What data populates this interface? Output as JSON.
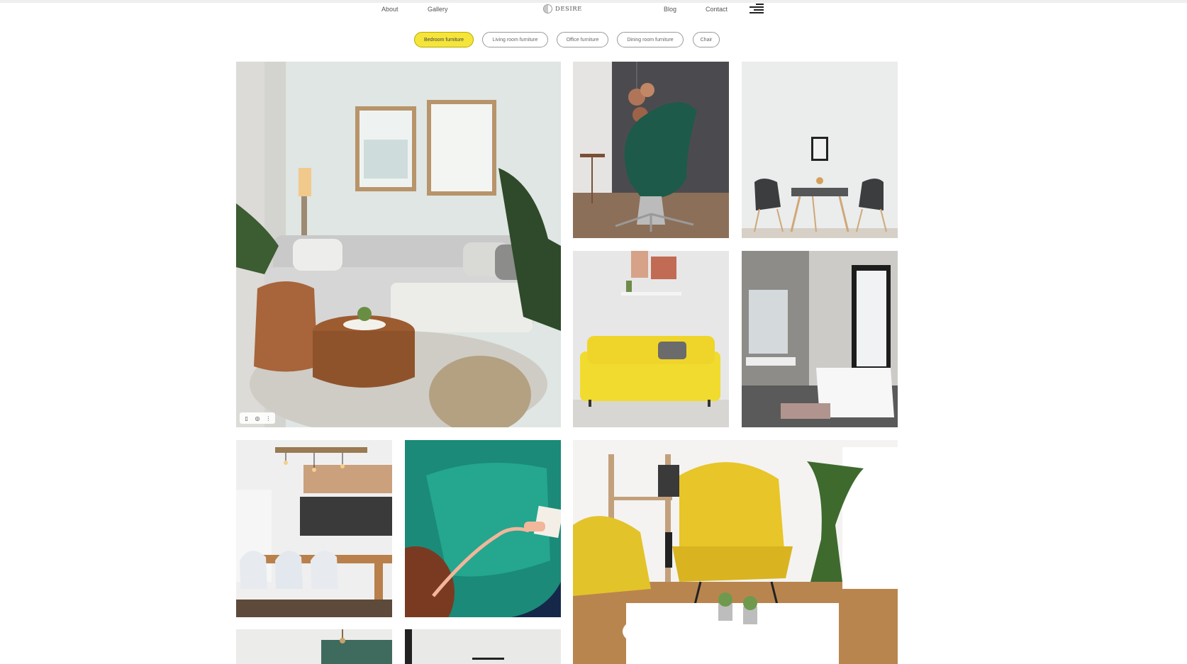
{
  "nav": {
    "about": "About",
    "gallery": "Gallery",
    "logo_text": "DESIRE",
    "blog": "Blog",
    "contact": "Contact",
    "menu_icon": "hamburger-menu-icon"
  },
  "filters": [
    {
      "label": "Bedroom furniture",
      "active": true
    },
    {
      "label": "Living room furniture",
      "active": false
    },
    {
      "label": "Office furniture",
      "active": false
    },
    {
      "label": "Dining room furniture",
      "active": false
    },
    {
      "label": "Chair",
      "active": false
    }
  ],
  "colors": {
    "active_chip": "#f5e43a",
    "text": "#555555"
  },
  "gallery": {
    "image_toolbar_icons": [
      "bookmark-icon",
      "camera-icon",
      "more-options-icon"
    ]
  }
}
